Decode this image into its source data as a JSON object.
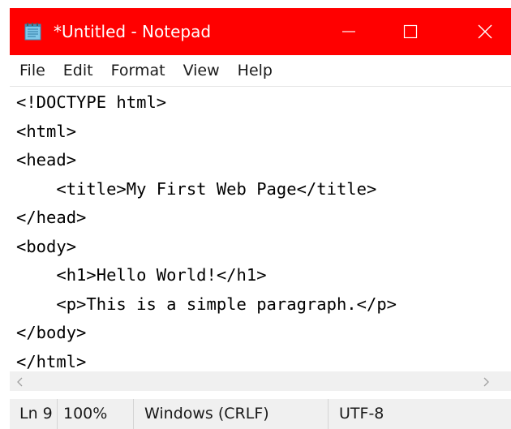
{
  "window": {
    "title": "*Untitled - Notepad",
    "icon": "notepad-icon",
    "controls": [
      "minimize-icon",
      "maximize-icon",
      "close-icon"
    ],
    "titlebar_color": "#ff0000"
  },
  "menu": {
    "items": [
      "File",
      "Edit",
      "Format",
      "View",
      "Help"
    ]
  },
  "editor": {
    "lines": [
      "<!DOCTYPE html>",
      "<html>",
      "<head>",
      "    <title>My First Web Page</title>",
      "</head>",
      "<body>",
      "    <h1>Hello World!</h1>",
      "    <p>This is a simple paragraph.</p>",
      "</body>",
      "</html>"
    ]
  },
  "status": {
    "position": "Ln 9",
    "zoom": "100%",
    "line_ending": "Windows (CRLF)",
    "encoding": "UTF-8"
  }
}
